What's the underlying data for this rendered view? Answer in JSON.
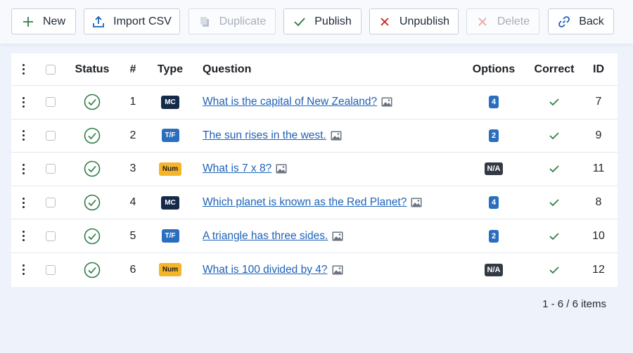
{
  "toolbar": {
    "buttons": [
      {
        "label": "New",
        "icon": "plus-icon",
        "disabled": false
      },
      {
        "label": "Import CSV",
        "icon": "upload-icon",
        "disabled": false
      },
      {
        "label": "Duplicate",
        "icon": "copy-icon",
        "disabled": true
      },
      {
        "label": "Publish",
        "icon": "check-icon",
        "disabled": false
      },
      {
        "label": "Unpublish",
        "icon": "x-icon",
        "disabled": false
      },
      {
        "label": "Delete",
        "icon": "x-icon",
        "disabled": true
      },
      {
        "label": "Back",
        "icon": "link-icon",
        "disabled": false
      }
    ]
  },
  "table": {
    "headers": {
      "status": "Status",
      "number": "#",
      "type": "Type",
      "question": "Question",
      "options": "Options",
      "correct": "Correct",
      "id": "ID"
    },
    "rows": [
      {
        "number": "1",
        "type": "MC",
        "question": "What is the capital of New Zealand?",
        "options": "4",
        "id": "7"
      },
      {
        "number": "2",
        "type": "T/F",
        "question": "The sun rises in the west.",
        "options": "2",
        "id": "9"
      },
      {
        "number": "3",
        "type": "Num",
        "question": "What is 7 x 8?",
        "options": "N/A",
        "id": "11"
      },
      {
        "number": "4",
        "type": "MC",
        "question": "Which planet is known as the Red Planet?",
        "options": "4",
        "id": "8"
      },
      {
        "number": "5",
        "type": "T/F",
        "question": "A triangle has three sides.",
        "options": "2",
        "id": "10"
      },
      {
        "number": "6",
        "type": "Num",
        "question": "What is 100 divided by 4?",
        "options": "N/A",
        "id": "12"
      }
    ]
  },
  "pagination": {
    "summary": "1 - 6 / 6 items"
  },
  "colors": {
    "published_green": "#2e7d46",
    "link_blue": "#1e62b8",
    "delete_red": "#c62828",
    "page_background": "#eef2fa"
  }
}
